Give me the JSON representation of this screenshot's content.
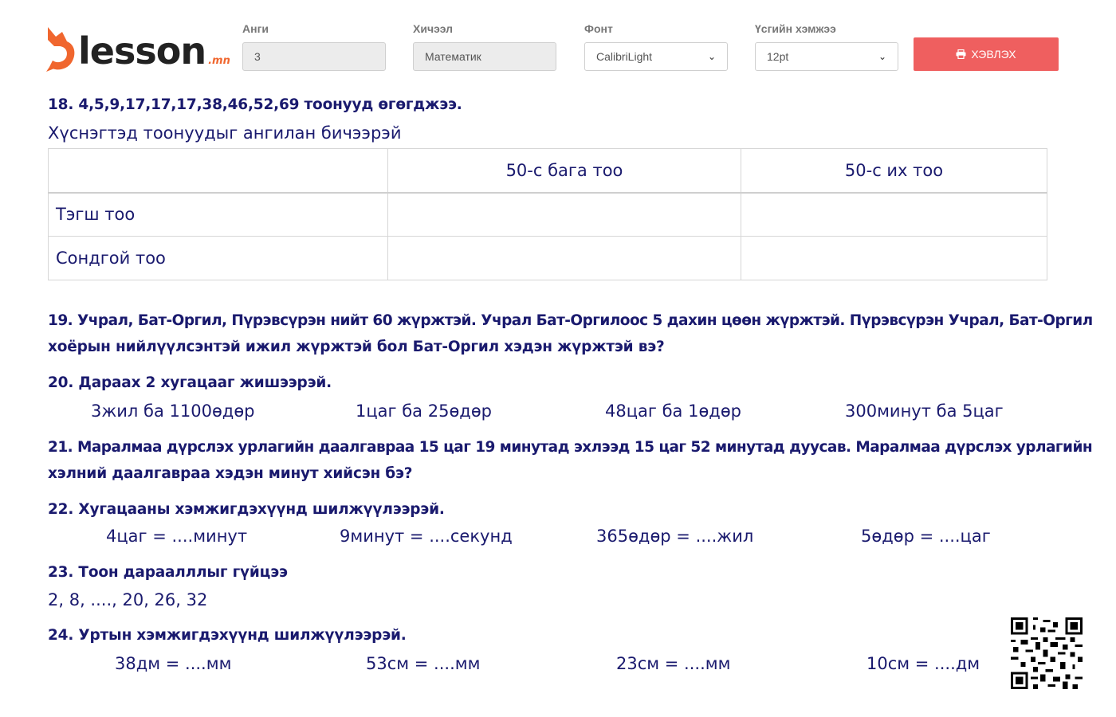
{
  "header": {
    "logo_text": "lesson",
    "logo_tld": ".mn",
    "fields": {
      "grade": {
        "label": "Анги",
        "value": "3"
      },
      "subject": {
        "label": "Хичээл",
        "value": "Математик"
      },
      "font": {
        "label": "Фонт",
        "value": "CalibriLight"
      },
      "size": {
        "label": "Үсгийн хэмжээ",
        "value": "12pt"
      }
    },
    "print_label": "ХЭВЛЭХ"
  },
  "q18": {
    "title": "18. 4,5,9,17,17,17,38,46,52,69 тоонууд өгөгджээ.",
    "instruction": "Хүснэгтэд тоонуудыг ангилан бичээрэй",
    "table": {
      "headers": [
        "",
        "50-с бага тоо",
        "50-с их тоо"
      ],
      "rows": [
        "Тэгш тоо",
        "Сондгой тоо"
      ]
    }
  },
  "q19": {
    "line1": "19. Учрал, Бат-Оргил, Пүрэвсүрэн нийт 60 жүржтэй. Учрал Бат-Оргилоос 5 дахин цөөн жүржтэй. Пүрэвсүрэн Учрал, Бат-Оргил",
    "line2": "хоёрын нийлүүлсэнтэй ижил жүржтэй бол Бат-Оргил хэдэн жүржтэй вэ?"
  },
  "q20": {
    "title": "20. Дараах 2 хугацааг жишээрэй.",
    "items": [
      "3жил ба 1100өдөр",
      "1цаг ба 25өдөр",
      "48цаг ба 1өдөр",
      "300минут ба 5цаг"
    ]
  },
  "q21": {
    "line1": "21. Маралмаа дүрслэх урлагийн даалгавраа 15 цаг 19 минутад эхлээд 15 цаг 52 минутад дуусав. Маралмаа дүрслэх урлагийн",
    "line2": "хэлний даалгавраа хэдэн минут хийсэн бэ?"
  },
  "q22": {
    "title": "22. Хугацааны хэмжигдэхүүнд шилжүүлээрэй.",
    "items": [
      "4цаг = ....минут",
      "9минут = ....секунд",
      "365өдөр = ....жил",
      "5өдөр = ....цаг"
    ]
  },
  "q23": {
    "title": "23. Тоон дараалллыг гүйцээ",
    "sequence": "2, 8, ....,  20, 26, 32"
  },
  "q24": {
    "title": "24. Уртын хэмжигдэхүүнд шилжүүлээрэй.",
    "items": [
      "38дм = ....мм",
      "53см = ....мм",
      "23см = ....мм",
      "10см = ....дм"
    ]
  },
  "icons": {
    "logo": "fox-logo-icon",
    "print": "printer-icon",
    "qr": "qr-code-icon"
  },
  "colors": {
    "brand": "#f0662e",
    "print_button": "#ef5f5f",
    "text": "#1a1a6e"
  }
}
